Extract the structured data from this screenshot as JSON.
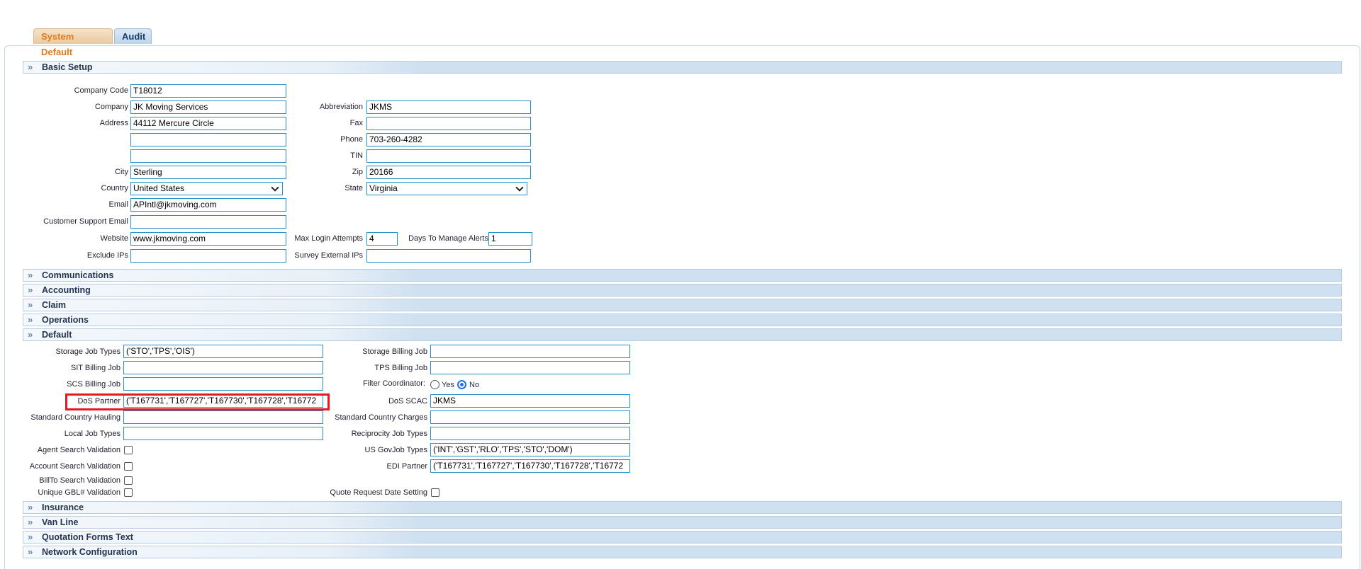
{
  "tabs": {
    "system_default": "System Default",
    "audit": "Audit"
  },
  "sections": {
    "basic_setup": "Basic Setup",
    "communications": "Communications",
    "accounting": "Accounting",
    "claim": "Claim",
    "operations": "Operations",
    "default": "Default",
    "insurance": "Insurance",
    "van_line": "Van Line",
    "quotation_forms_text": "Quotation Forms Text",
    "network_configuration": "Network Configuration"
  },
  "basic": {
    "company_code": {
      "label": "Company Code",
      "value": "T18012"
    },
    "company": {
      "label": "Company",
      "value": "JK Moving Services"
    },
    "abbreviation": {
      "label": "Abbreviation",
      "value": "JKMS"
    },
    "address": {
      "label": "Address",
      "value": "44112 Mercure Circle"
    },
    "fax": {
      "label": "Fax",
      "value": ""
    },
    "address2": {
      "value": ""
    },
    "phone": {
      "label": "Phone",
      "value": "703-260-4282"
    },
    "address3": {
      "value": ""
    },
    "tin": {
      "label": "TIN",
      "value": ""
    },
    "city": {
      "label": "City",
      "value": "Sterling"
    },
    "zip": {
      "label": "Zip",
      "value": "20166"
    },
    "country": {
      "label": "Country",
      "value": "United States"
    },
    "state": {
      "label": "State",
      "value": "Virginia"
    },
    "email": {
      "label": "Email",
      "value": "APIntl@jkmoving.com"
    },
    "customer_support_email": {
      "label": "Customer Support Email",
      "value": ""
    },
    "website": {
      "label": "Website",
      "value": "www.jkmoving.com"
    },
    "max_login_attempts": {
      "label": "Max Login Attempts",
      "value": "4"
    },
    "days_to_manage_alerts": {
      "label": "Days To Manage Alerts",
      "value": "1"
    },
    "exclude_ips": {
      "label": "Exclude IPs",
      "value": ""
    },
    "survey_external_ips": {
      "label": "Survey External IPs",
      "value": ""
    }
  },
  "defaults": {
    "storage_job_types": {
      "label": "Storage Job Types",
      "value": "('STO','TPS','OIS')"
    },
    "storage_billing_job": {
      "label": "Storage Billing Job",
      "value": ""
    },
    "sit_billing_job": {
      "label": "SIT Billing Job",
      "value": ""
    },
    "tps_billing_job": {
      "label": "TPS Billing Job",
      "value": ""
    },
    "scs_billing_job": {
      "label": "SCS Billing Job",
      "value": ""
    },
    "filter_coordinator": {
      "label": "Filter Coordinator:",
      "yes": "Yes",
      "no": "No",
      "selected": "No"
    },
    "dos_partner": {
      "label": "DoS Partner",
      "value": "('T167731','T167727','T167730','T167728','T16772"
    },
    "dos_scac": {
      "label": "DoS SCAC",
      "value": "JKMS"
    },
    "standard_country_hauling": {
      "label": "Standard Country Hauling",
      "value": ""
    },
    "standard_country_charges": {
      "label": "Standard Country Charges",
      "value": ""
    },
    "local_job_types": {
      "label": "Local Job Types",
      "value": ""
    },
    "reciprocity_job_types": {
      "label": "Reciprocity Job Types",
      "value": ""
    },
    "agent_search_validation": {
      "label": "Agent Search Validation",
      "checked": false
    },
    "us_govjob_types": {
      "label": "US GovJob Types",
      "value": "('INT','GST','RLO','TPS','STO','DOM')"
    },
    "account_search_validation": {
      "label": "Account Search Validation",
      "checked": false
    },
    "edi_partner": {
      "label": "EDI Partner",
      "value": "('T167731','T167727','T167730','T167728','T16772"
    },
    "billto_search_validation": {
      "label": "BillTo Search Validation",
      "checked": false
    },
    "unique_gbl_validation": {
      "label": "Unique GBL# Validation",
      "checked": false
    },
    "quote_request_date_setting": {
      "label": "Quote Request Date Setting",
      "checked": false
    }
  },
  "colors": {
    "accent_tab": "#e07b1e",
    "input_border": "#2a8fc8",
    "highlight": "#e21b23"
  }
}
